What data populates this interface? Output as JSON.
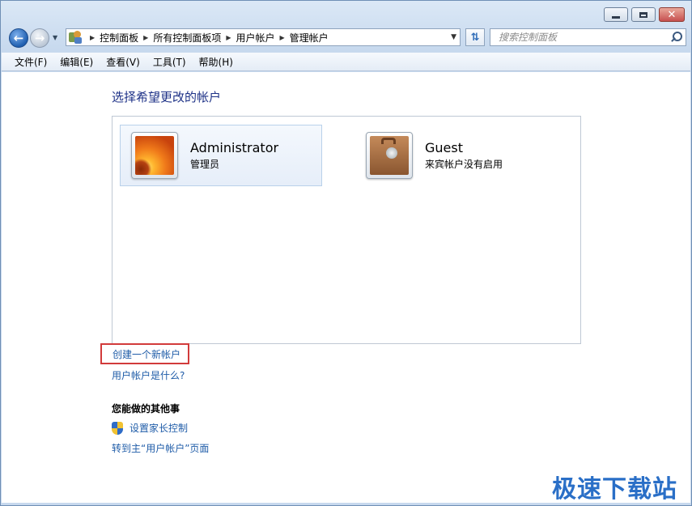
{
  "window": {
    "minimize_label": "–",
    "maximize_label": "□",
    "close_label": "✕"
  },
  "nav": {
    "breadcrumbs": [
      "控制面板",
      "所有控制面板项",
      "用户帐户",
      "管理帐户"
    ],
    "search_placeholder": "搜索控制面板"
  },
  "menu": {
    "items": [
      "文件(F)",
      "编辑(E)",
      "查看(V)",
      "工具(T)",
      "帮助(H)"
    ]
  },
  "main": {
    "title": "选择希望更改的帐户",
    "accounts": [
      {
        "name": "Administrator",
        "subtitle": "管理员",
        "avatar": "flower"
      },
      {
        "name": "Guest",
        "subtitle": "来宾帐户没有启用",
        "avatar": "briefcase"
      }
    ],
    "create_link": "创建一个新帐户",
    "what_link": "用户帐户是什么?",
    "other_title": "您能做的其他事",
    "parental_link": "设置家长控制",
    "goto_link": "转到主“用户帐户”页面"
  },
  "watermark": "极速下载站",
  "colors": {
    "link": "#1f5ca8",
    "title": "#1e3287",
    "highlight_box": "#d23b3b"
  }
}
